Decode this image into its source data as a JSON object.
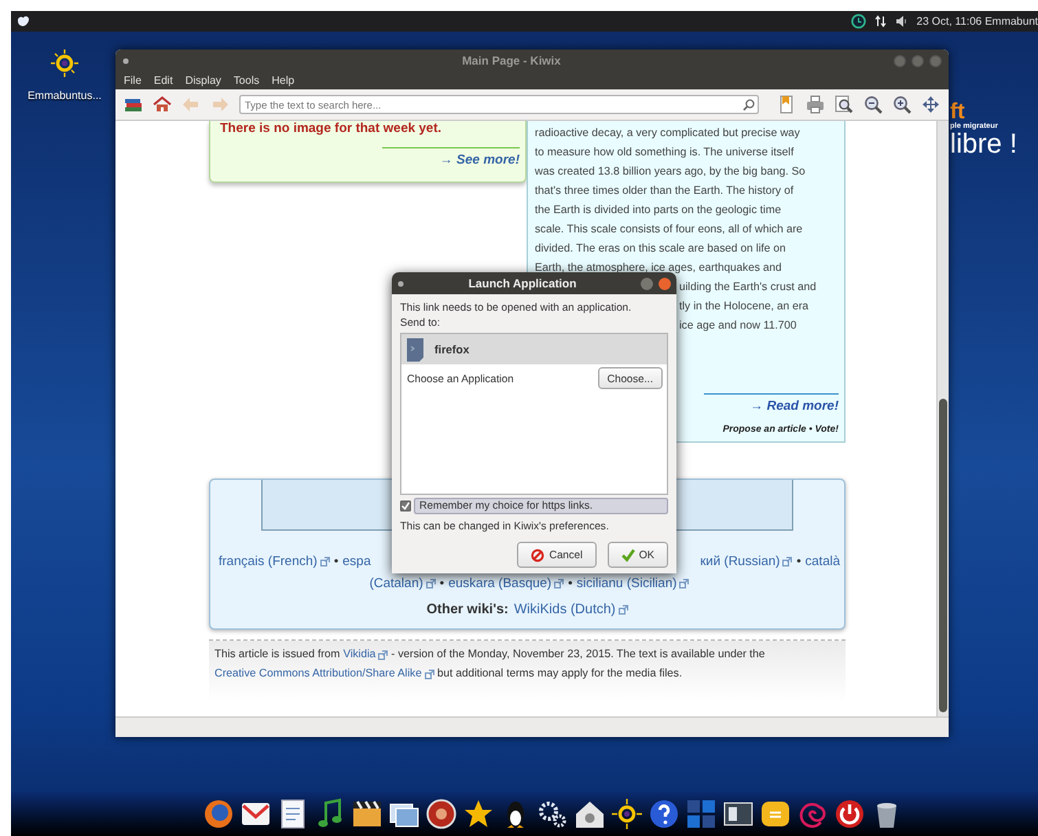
{
  "top_panel": {
    "clock": "23 Oct, 11:06 Emmabunt"
  },
  "desktop": {
    "icons": [
      {
        "label": "Emmabuntus..."
      }
    ],
    "wallpaper_texts": [
      {
        "kind": "logo",
        "text": "ft"
      },
      {
        "kind": "tagline",
        "text": "ple migrateur"
      },
      {
        "kind": "slogan",
        "text": "libre !"
      }
    ]
  },
  "window": {
    "title": "Main Page - Kiwix",
    "menu": [
      "File",
      "Edit",
      "Display",
      "Tools",
      "Help"
    ],
    "toolbar_left": [
      {
        "kind": "library",
        "disabled": false
      },
      {
        "kind": "home",
        "disabled": false
      },
      {
        "kind": "back",
        "disabled": true
      },
      {
        "kind": "forward",
        "disabled": true
      }
    ],
    "search": {
      "placeholder": "Type the text to search here..."
    },
    "toolbar_right": [
      {
        "kind": "bookmark"
      },
      {
        "kind": "print"
      },
      {
        "kind": "zoom_fit"
      },
      {
        "kind": "zoom_out"
      },
      {
        "kind": "zoom_in"
      },
      {
        "kind": "fullscreen"
      }
    ]
  },
  "article": {
    "image_box": {
      "notice": "There is no image for that week yet.",
      "link": "→ See more!"
    },
    "text_box": {
      "lines": [
        {
          "text": "radioactive decay, a very complicated but precise way",
          "covered": false
        },
        {
          "text": "to measure how old something is. The universe itself",
          "covered": false
        },
        {
          "text": "was created 13.8 billion years ago, by the big bang. So",
          "covered": false
        },
        {
          "text": "that's three times older than the Earth. The history of",
          "covered": false
        },
        {
          "text": "the Earth is divided into parts on the geologic time",
          "covered": false
        },
        {
          "text": "scale. This scale consists of four eons, all of which are",
          "covered": false
        },
        {
          "text": "divided. The eras on this scale are based on life on",
          "covered": false
        },
        {
          "text": "Earth, the atmosphere, ice ages, earthquakes and",
          "covered": false
        },
        {
          "text": "uilding the Earth's crust and",
          "covered": true
        },
        {
          "text": "tly in the Holocene, an era",
          "covered": true
        },
        {
          "text": "ice age and now 11.700",
          "covered": true
        }
      ],
      "link": "→ Read more!",
      "footer": "Propose an article • Vote!"
    },
    "languages": {
      "rows": [
        {
          "items": [
            {
              "kind": "link",
              "text": "français (French)",
              "external": true
            },
            {
              "kind": "sep",
              "text": "•"
            },
            {
              "kind": "link",
              "text": "espa",
              "external": false
            },
            {
              "kind": "gap"
            },
            {
              "kind": "link",
              "text": "кий (Russian)",
              "external": true
            },
            {
              "kind": "sep",
              "text": "•"
            },
            {
              "kind": "link",
              "text": "català",
              "external": false
            }
          ]
        },
        {
          "items": [
            {
              "kind": "link",
              "text": "(Catalan)",
              "external": true
            },
            {
              "kind": "sep",
              "text": "•"
            },
            {
              "kind": "link",
              "text": "euskara (Basque)",
              "external": true
            },
            {
              "kind": "sep",
              "text": "•"
            },
            {
              "kind": "link",
              "text": "sicilianu (Sicilian)",
              "external": true
            }
          ]
        }
      ]
    },
    "other_wikis": {
      "label": "Other wiki's:",
      "link": "WikiKids (Dutch)"
    },
    "footer": {
      "segments": [
        {
          "kind": "text",
          "text": "This article is issued from "
        },
        {
          "kind": "link",
          "text": "Vikidia"
        },
        {
          "kind": "text",
          "text": " - version of the Monday, November 23, 2015. The text is available under the "
        },
        {
          "kind": "link",
          "text": "Creative Commons Attribution/Share Alike"
        },
        {
          "kind": "text",
          "text": " but additional terms may apply for the media files."
        }
      ]
    }
  },
  "dialog": {
    "title": "Launch Application",
    "message": "This link needs to be opened with an application.",
    "send_to": "Send to:",
    "apps": [
      {
        "name": "firefox",
        "selected": true
      }
    ],
    "choose_label": "Choose an Application",
    "choose_button": "Choose...",
    "remember": {
      "label": "Remember my choice for https links.",
      "checked": true
    },
    "note": "This can be changed in Kiwix's preferences.",
    "buttons": [
      {
        "kind": "cancel",
        "label": "Cancel"
      },
      {
        "kind": "ok",
        "label": "OK"
      }
    ]
  }
}
